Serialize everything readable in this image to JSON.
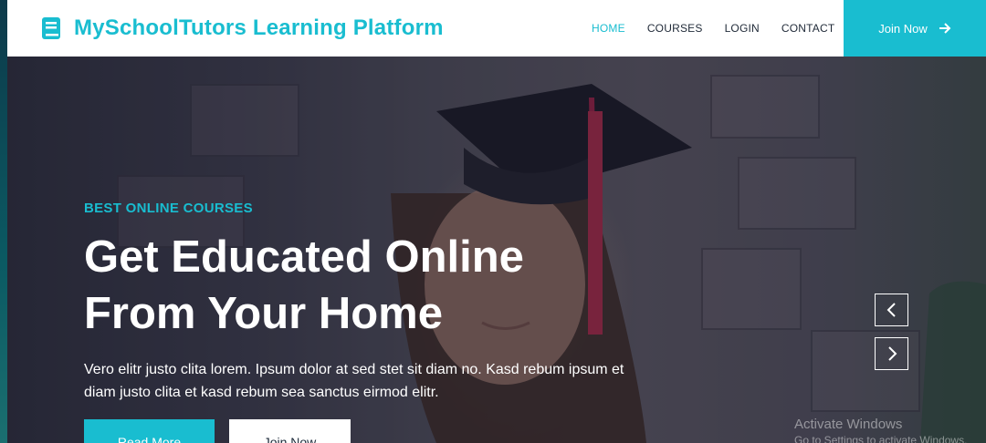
{
  "brand": {
    "title": "MySchoolTutors Learning Platform",
    "icon": "book-icon"
  },
  "nav": {
    "items": [
      {
        "label": "HOME",
        "active": true
      },
      {
        "label": "COURSES",
        "active": false
      },
      {
        "label": "LOGIN",
        "active": false
      },
      {
        "label": "CONTACT",
        "active": false
      }
    ],
    "join_label": "Join Now",
    "join_icon": "arrow-right-icon"
  },
  "hero": {
    "eyebrow": "BEST ONLINE COURSES",
    "headline_line1": "Get Educated Online",
    "headline_line2": "From Your Home",
    "description": "Vero elitr justo clita lorem. Ipsum dolor at sed stet sit diam no. Kasd rebum ipsum et diam justo clita et kasd rebum sea sanctus eirmod elitr.",
    "read_more_label": "Read More",
    "join_now_label": "Join Now",
    "prev_icon": "chevron-left-icon",
    "next_icon": "chevron-right-icon"
  },
  "watermark": {
    "line1": "Activate Windows",
    "line2": "Go to Settings to activate Windows."
  },
  "colors": {
    "accent": "#19bdd0",
    "nav_text": "#1f2937",
    "white": "#ffffff"
  }
}
